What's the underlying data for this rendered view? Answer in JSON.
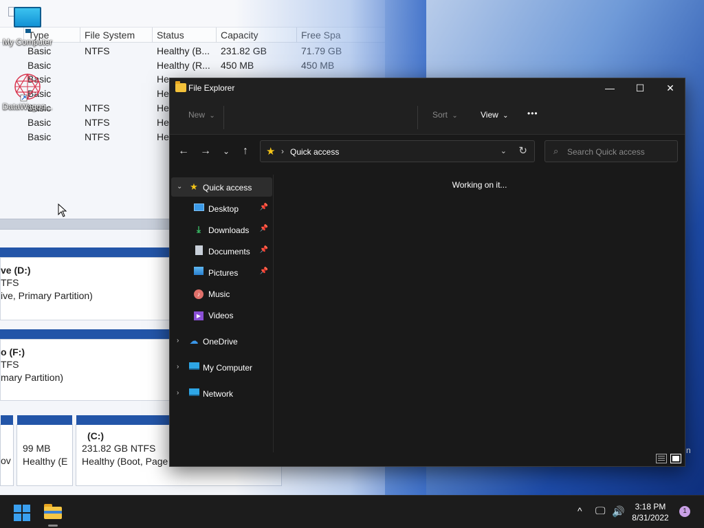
{
  "disk_management": {
    "columns": [
      "Type",
      "File System",
      "Status",
      "Capacity",
      "Free Spa"
    ],
    "rows": [
      {
        "type": "Basic",
        "fs": "NTFS",
        "status": "Healthy (B...",
        "capacity": "231.82 GB",
        "free": "71.79 GB"
      },
      {
        "type": "Basic",
        "fs": "",
        "status": "Healthy (R...",
        "capacity": "450 MB",
        "free": "450 MB"
      },
      {
        "type": "Basic",
        "fs": "",
        "status": "He",
        "capacity": "",
        "free": ""
      },
      {
        "type": "Basic",
        "fs": "",
        "status": "He",
        "capacity": "",
        "free": ""
      },
      {
        "type": "Basic",
        "fs": "NTFS",
        "status": "He",
        "capacity": "",
        "free": ""
      },
      {
        "type": "Basic",
        "fs": "NTFS",
        "status": "He",
        "capacity": "",
        "free": ""
      },
      {
        "type": "Basic",
        "fs": "NTFS",
        "status": "He",
        "capacity": "",
        "free": ""
      }
    ],
    "volume_d": {
      "name": "ve  (D:)",
      "fs": "TFS",
      "status": "ive, Primary Partition)"
    },
    "volume_f": {
      "name": "o  (F:)",
      "fs": "TFS",
      "status": "mary Partition)"
    },
    "bottom": {
      "p1_status": "ov",
      "p2_size": "99 MB",
      "p2_status": "Healthy (E",
      "p3_name": "(C:)",
      "p3_size": "231.82 GB NTFS",
      "p3_status": "Healthy (Boot, Page"
    },
    "edge_char": "n"
  },
  "desktop": {
    "icons": [
      {
        "label": "My Computer"
      },
      {
        "label": "DataWagon..."
      }
    ]
  },
  "explorer": {
    "title": "File Explorer",
    "window_controls": {
      "minimize": "—",
      "maximize": "☐",
      "close": "✕"
    },
    "command_bar": {
      "new": "New",
      "sort": "Sort",
      "view": "View",
      "more": "•••",
      "caret": "⌄"
    },
    "nav_buttons": {
      "back": "←",
      "forward": "→",
      "recent": "⌄",
      "up": "↑"
    },
    "address": {
      "location": "Quick access",
      "separator": "›",
      "dropdown": "⌄",
      "refresh": "↻"
    },
    "search": {
      "placeholder": "Search Quick access"
    },
    "sidebar": {
      "quick_access": "Quick access",
      "pinned": [
        {
          "label": "Desktop",
          "pinned": true
        },
        {
          "label": "Downloads",
          "pinned": true
        },
        {
          "label": "Documents",
          "pinned": true
        },
        {
          "label": "Pictures",
          "pinned": true
        },
        {
          "label": "Music",
          "pinned": false
        },
        {
          "label": "Videos",
          "pinned": false
        }
      ],
      "groups": [
        {
          "label": "OneDrive"
        },
        {
          "label": "My Computer"
        },
        {
          "label": "Network"
        }
      ]
    },
    "content": {
      "status": "Working on it..."
    }
  },
  "taskbar": {
    "time": "3:18 PM",
    "date": "8/31/2022",
    "notification_count": "1",
    "tray": {
      "chevron": "^",
      "network": "🖵",
      "volume": "🔊"
    }
  },
  "colors": {
    "explorer_bg": "#191919",
    "accent_blue": "#3aa0f0",
    "star": "#f5c518",
    "taskbar_bg": "#1c1c1c"
  }
}
